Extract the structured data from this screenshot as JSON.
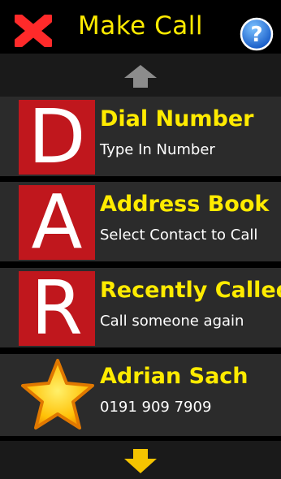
{
  "header": {
    "title": "Make Call",
    "close_icon": "close-icon",
    "help_icon": "help-icon"
  },
  "colors": {
    "accent_yellow": "#ffeb00",
    "tile_red": "#c0171d",
    "item_bg": "#2b2b2b"
  },
  "items": [
    {
      "tile": "D",
      "title": "Dial Number",
      "subtitle": "Type In Number"
    },
    {
      "tile": "A",
      "title": "Address Book",
      "subtitle": "Select Contact to Call"
    },
    {
      "tile": "R",
      "title": "Recently Called",
      "subtitle": "Call someone again"
    },
    {
      "icon": "star-icon",
      "title": "Adrian Sach",
      "subtitle": "0191 909 7909"
    }
  ],
  "scroll": {
    "up_icon": "arrow-up-icon",
    "down_icon": "arrow-down-icon"
  }
}
